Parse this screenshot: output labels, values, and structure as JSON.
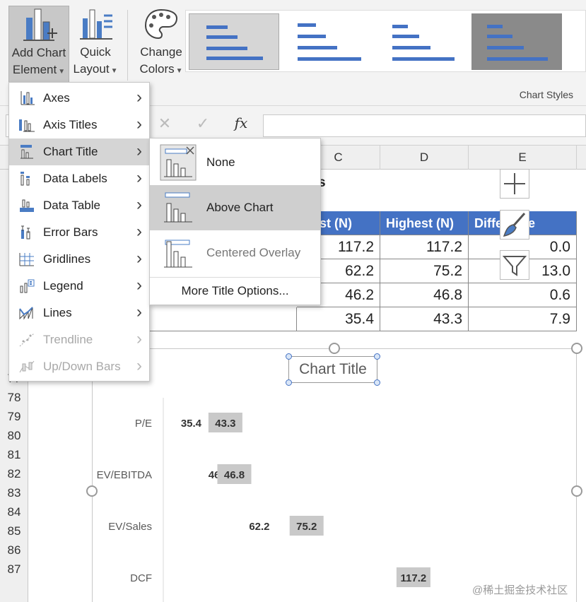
{
  "ribbon": {
    "add_chart_element": {
      "line1": "Add Chart",
      "line2": "Element"
    },
    "quick_layout": {
      "line1": "Quick",
      "line2": "Layout"
    },
    "change_colors": {
      "line1": "Change",
      "line2": "Colors"
    },
    "chart_styles_label": "Chart Styles"
  },
  "formula_bar": {
    "cancel_icon": "close-icon",
    "enter_icon": "check-icon",
    "function_label": "fx"
  },
  "columns": [
    "C",
    "D",
    "E"
  ],
  "rows": [
    "77",
    "78",
    "79",
    "80",
    "81",
    "82",
    "83",
    "84",
    "85",
    "86",
    "87"
  ],
  "sheet": {
    "title_fragment": "s",
    "headers": [
      "west (N)",
      "Highest (N)",
      "Diffe",
      "e"
    ],
    "table": [
      [
        "117.2",
        "117.2",
        "0.0"
      ],
      [
        "62.2",
        "75.2",
        "13.0"
      ],
      [
        "46.2",
        "46.8",
        "0.6"
      ],
      [
        "35.4",
        "43.3",
        "7.9"
      ]
    ]
  },
  "menu": {
    "items": [
      {
        "label": "Axes",
        "icon": "axes-icon",
        "enabled": true
      },
      {
        "label": "Axis Titles",
        "icon": "axis-titles-icon",
        "enabled": true
      },
      {
        "label": "Chart Title",
        "icon": "chart-title-icon",
        "enabled": true,
        "highlighted": true
      },
      {
        "label": "Data Labels",
        "icon": "data-labels-icon",
        "enabled": true
      },
      {
        "label": "Data Table",
        "icon": "data-table-icon",
        "enabled": true
      },
      {
        "label": "Error Bars",
        "icon": "error-bars-icon",
        "enabled": true
      },
      {
        "label": "Gridlines",
        "icon": "gridlines-icon",
        "enabled": true
      },
      {
        "label": "Legend",
        "icon": "legend-icon",
        "enabled": true
      },
      {
        "label": "Lines",
        "icon": "lines-icon",
        "enabled": true
      },
      {
        "label": "Trendline",
        "icon": "trendline-icon",
        "enabled": false
      },
      {
        "label": "Up/Down Bars",
        "icon": "up-down-bars-icon",
        "enabled": false
      }
    ]
  },
  "submenu": {
    "items": [
      {
        "label": "None"
      },
      {
        "label": "Above Chart",
        "highlighted": true
      },
      {
        "label": "Centered Overlay"
      }
    ],
    "more": "More Title Options..."
  },
  "chart": {
    "title": "Chart Title",
    "side_buttons": [
      "plus-icon",
      "brush-icon",
      "filter-icon"
    ]
  },
  "chart_data": {
    "type": "bar",
    "title": "Chart Title",
    "categories": [
      "P/E",
      "EV/EBITDA",
      "EV/Sales",
      "DCF"
    ],
    "series": [
      {
        "values": [
          35.4,
          46.2,
          62.2,
          117.2
        ]
      },
      {
        "values": [
          43.3,
          46.8,
          75.2,
          117.2
        ]
      }
    ],
    "value_labels_low": [
      "35.4",
      "46.2",
      "62.2",
      ""
    ],
    "value_labels_high": [
      "43.3",
      "46.8",
      "75.2",
      "117.2"
    ],
    "xlim": [
      0,
      140
    ],
    "grid": false,
    "legend": "none"
  },
  "watermark": "@稀土掘金技术社区"
}
